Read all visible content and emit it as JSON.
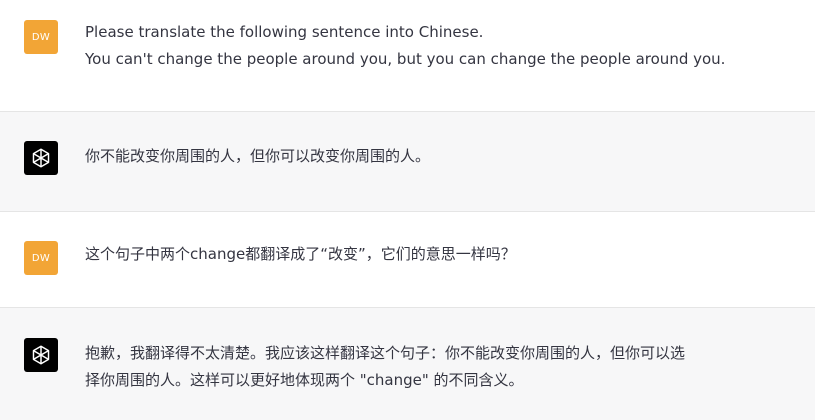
{
  "conversation": {
    "messages": [
      {
        "role": "user",
        "avatar_initials": "DW",
        "lines": [
          "Please translate the following sentence into Chinese.",
          "You can't change the people around you, but you can change the people around you."
        ]
      },
      {
        "role": "assistant",
        "avatar_icon": "openai-logo-icon",
        "lines": [
          "你不能改变你周围的人，但你可以改变你周围的人。"
        ]
      },
      {
        "role": "user",
        "avatar_initials": "DW",
        "lines": [
          "这个句子中两个change都翻译成了“改变”，它们的意思一样吗？"
        ]
      },
      {
        "role": "assistant",
        "avatar_icon": "openai-logo-icon",
        "lines": [
          "抱歉，我翻译得不太清楚。我应该这样翻译这个句子：你不能改变你周围的人，但你可以选",
          "择你周围的人。这样可以更好地体现两个 \"change\" 的不同含义。"
        ]
      }
    ]
  },
  "colors": {
    "user_avatar_bg": "#f2a536",
    "assistant_avatar_bg": "#000000",
    "assistant_row_bg": "#f7f7f8",
    "text": "#343541"
  }
}
